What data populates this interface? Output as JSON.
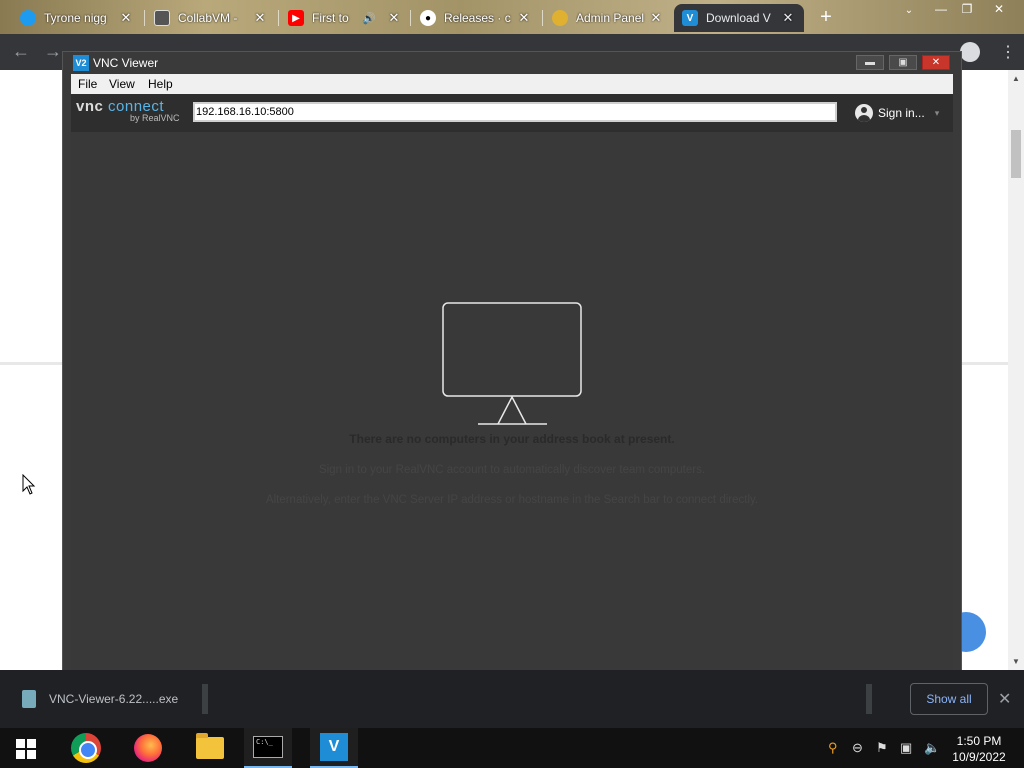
{
  "browser": {
    "tabs": [
      {
        "label": "Tyrone nigg",
        "icon": "twitter-icon"
      },
      {
        "label": "CollabVM -",
        "icon": "collabvm-icon"
      },
      {
        "label": "First to",
        "icon": "youtube-icon"
      },
      {
        "label": "Releases · c",
        "icon": "github-icon"
      },
      {
        "label": "Admin Panel",
        "icon": "admin-icon"
      },
      {
        "label": "Download V",
        "icon": "vnc-icon"
      }
    ],
    "new_tab": "+",
    "close_glyph": "✕"
  },
  "vnc": {
    "title": "VNC Viewer",
    "logo": "V2",
    "menu": [
      "File",
      "View",
      "Help"
    ],
    "brand_main": "vnc",
    "brand_accent": "connect",
    "brand_sub": "by RealVNC",
    "address_value": "192.168.16.10:5800",
    "sign_in": "Sign in...",
    "empty_title": "There are no computers in your address book at present.",
    "empty_line1": "Sign in to your RealVNC account to automatically discover team computers.",
    "empty_line2": "Alternatively, enter the VNC Server IP address or hostname in the Search bar to connect directly."
  },
  "downloads": {
    "file": "VNC-Viewer-6.22.....exe",
    "show_all": "Show all",
    "close": "✕"
  },
  "taskbar": {
    "apps": [
      "chrome-icon",
      "firefox-icon",
      "file-explorer-icon",
      "cmd-icon",
      "vnc-viewer-icon"
    ],
    "time": "1:50 PM",
    "date": "10/9/2022"
  },
  "colors": {
    "vnc_bg": "#393939",
    "accent": "#1f8dd6",
    "close_red": "#c8352b",
    "link_blue": "#8ab4f8"
  }
}
